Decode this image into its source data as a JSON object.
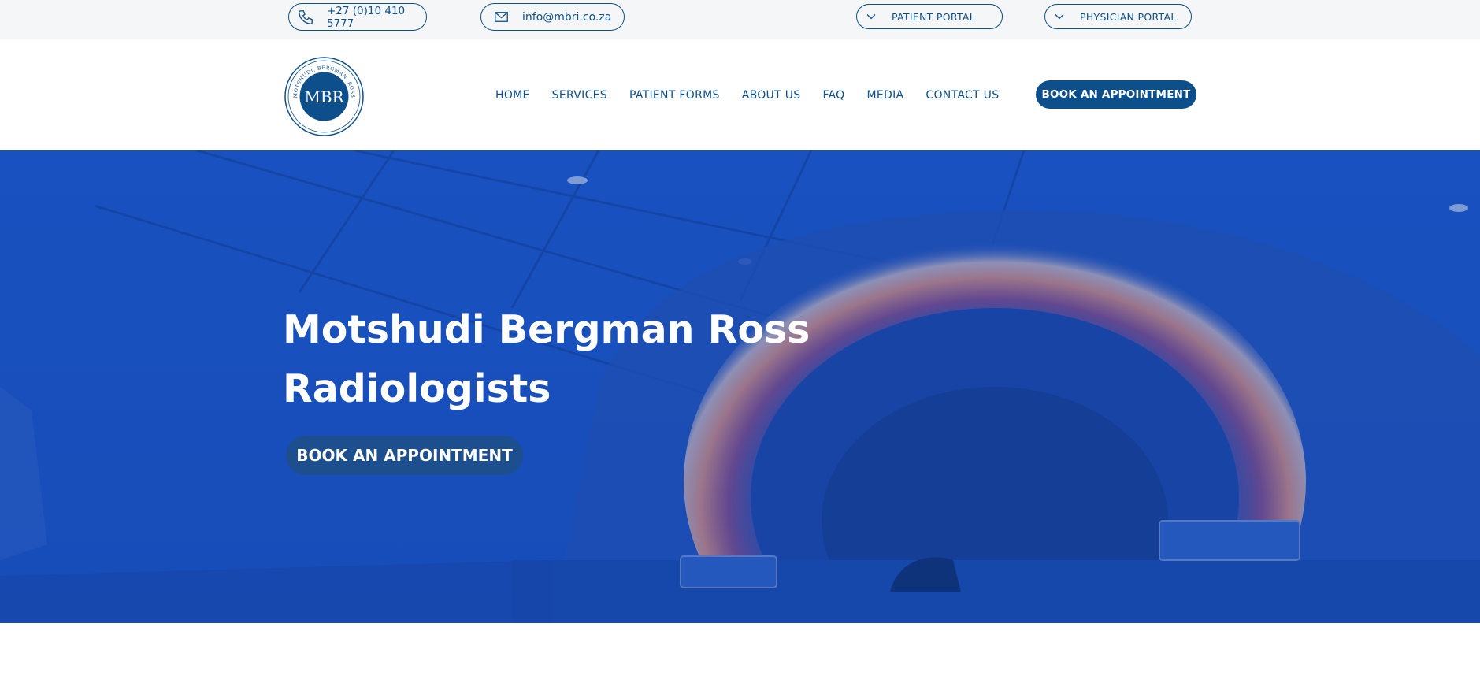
{
  "topbar": {
    "phone": "+27 (0)10 410 5777",
    "email": "info@mbri.co.za",
    "patient_portal": "PATIENT PORTAL",
    "physician_portal": "PHYSICIAN PORTAL"
  },
  "logo": {
    "initials": "MBR",
    "ring_top": "MOTSHUDI, BERGMAN, ROSS",
    "ring_bottom": "RADIOLOGISTS"
  },
  "nav": {
    "items": [
      {
        "label": "HOME"
      },
      {
        "label": "SERVICES"
      },
      {
        "label": "PATIENT FORMS"
      },
      {
        "label": "ABOUT US"
      },
      {
        "label": "FAQ"
      },
      {
        "label": "MEDIA"
      },
      {
        "label": "CONTACT US"
      }
    ],
    "cta": "BOOK AN APPOINTMENT"
  },
  "hero": {
    "title_line1": "Motshudi Bergman Ross",
    "title_line2": "Radiologists",
    "cta": "BOOK AN APPOINTMENT"
  },
  "colors": {
    "brand": "#0d4f8b",
    "hero_blue": "#1a56c8",
    "white": "#ffffff"
  }
}
